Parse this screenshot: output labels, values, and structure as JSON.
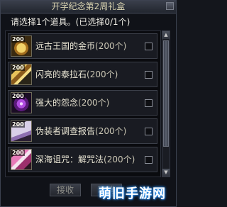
{
  "window": {
    "title": "开学纪念第2周礼盒",
    "prompt": "请选择1个道具。(已选择0/1个)"
  },
  "items": [
    {
      "name": "远古王国的金币",
      "count": "(200个)",
      "badge": "200",
      "icon": "gold-coin-icon",
      "checked": false
    },
    {
      "name": "闪亮的泰拉石",
      "count": "(200个)",
      "badge": "200",
      "icon": "terra-stone-icon",
      "checked": false
    },
    {
      "name": "强大的怨念",
      "count": "(200个)",
      "badge": "200",
      "icon": "grudge-orb-icon",
      "checked": false
    },
    {
      "name": "伪装者调查报告",
      "count": "(200个)",
      "badge": "200",
      "icon": "report-scroll-icon",
      "checked": false
    },
    {
      "name": "深海诅咒：解咒法",
      "count": "(200个)",
      "badge": "200",
      "icon": "curse-book-icon",
      "checked": false
    }
  ],
  "buttons": {
    "receive": "接收",
    "cancel": "取消"
  },
  "watermark": "萌旧手游网",
  "colors": {
    "window_bg": "#101218",
    "text_light": "#ece8d6",
    "title_text": "#d8d2b0",
    "disabled_text": "#8e8e88"
  }
}
